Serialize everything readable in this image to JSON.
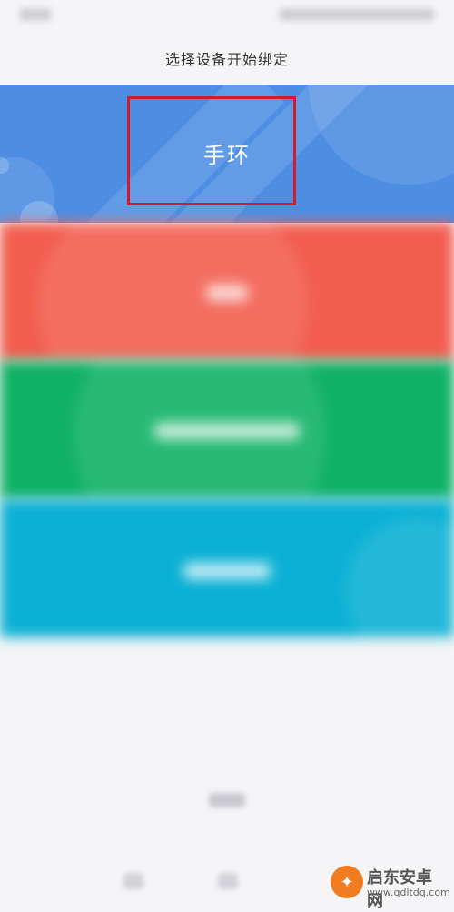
{
  "header": {
    "title": "选择设备开始绑定"
  },
  "devices": [
    {
      "label": "手环",
      "color": "#4d8ee3",
      "selected": true
    },
    {
      "label": "",
      "color": "#f25d4e"
    },
    {
      "label": "",
      "color": "#0fb165"
    },
    {
      "label": "",
      "color": "#0bb0d4"
    }
  ],
  "annotation": {
    "color": "#d11a2a"
  },
  "watermark": {
    "logo_icon": "fire-icon",
    "title": "启东安卓网",
    "url": "www.qdltdq.com"
  }
}
